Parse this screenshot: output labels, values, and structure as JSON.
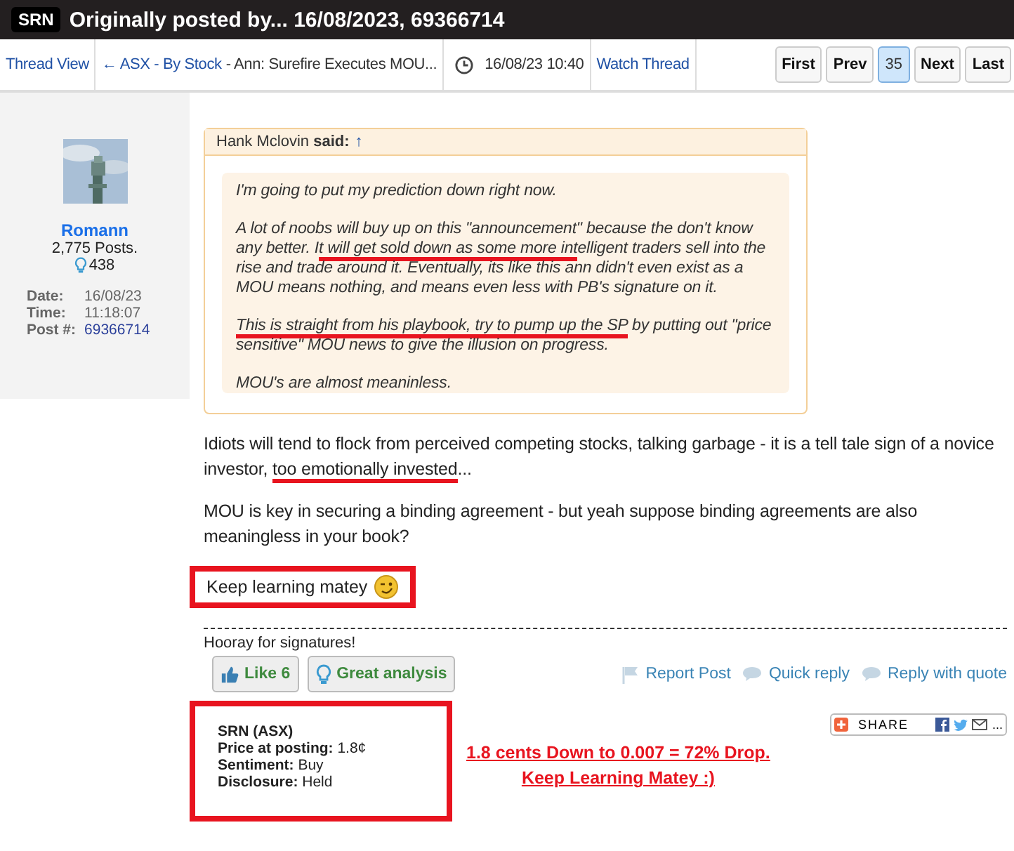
{
  "header": {
    "badge": "SRN",
    "title": "Originally posted by... 16/08/2023, 69366714"
  },
  "nav": {
    "thread_view": "Thread View",
    "crumb_link": "← ASX - By Stock",
    "crumb_rest": "- Ann: Surefire Executes MOU...",
    "time": "16/08/23 10:40",
    "watch": "Watch Thread",
    "pages": [
      {
        "label": "First",
        "selected": false
      },
      {
        "label": "Prev",
        "selected": false
      },
      {
        "label": "35",
        "selected": true
      },
      {
        "label": "Next",
        "selected": false
      },
      {
        "label": "Last",
        "selected": false
      }
    ]
  },
  "author": {
    "name": "Romann",
    "posts": "2,775 Posts.",
    "likes": "438",
    "details": [
      {
        "label": "Date:",
        "value": "16/08/23",
        "kind": "text"
      },
      {
        "label": "Time:",
        "value": "11:18:07",
        "kind": "text"
      },
      {
        "label": "Post #:",
        "value": "69366714",
        "kind": "link"
      }
    ]
  },
  "quote": {
    "heading": "Hank Mclovin **said:**",
    "arrow": "↑",
    "paragraphs": [
      [
        {
          "text": "I'm going to put my prediction down right now.",
          "underlined": false
        }
      ],
      [
        {
          "text": "A lot of noobs will buy up on this \"announcement\" because the don't know any better. I",
          "underlined": false
        },
        {
          "text": "t will get sold down as some more int",
          "underlined": true
        },
        {
          "text": "elligent traders sell into the rise and trade around it. Eventually, its like this ann didn't even exist as a MOU means nothing, and means even less with PB's signature on it.",
          "underlined": false
        }
      ],
      [
        {
          "text": "This is straight from his playbook, try to pump up the SP",
          "underlined": true
        },
        {
          "text": " by putting out \"price sensitive\" MOU news to give the illusion on progress.",
          "underlined": false
        }
      ],
      [
        {
          "text": "MOU's are almost meaninless.",
          "underlined": false
        }
      ]
    ]
  },
  "body": [
    [
      {
        "text": "Idiots will tend to flock from perceived competing stocks, talking garbage - it is a tell tale sign of a novice investor, ",
        "underlined": false
      },
      {
        "text": "too emotionally invested",
        "underlined": true
      },
      {
        "text": "...",
        "underlined": false
      }
    ],
    [
      {
        "text": "MOU is key in securing a binding agreement - but yeah suppose binding agreements are also meaningless in your book?",
        "underlined": false
      }
    ]
  ],
  "closing": {
    "text": "Keep learning matey",
    "highlighted": true
  },
  "signature": "Hooray for signatures!",
  "reactions": [
    {
      "label": "Like 6",
      "kind": "like"
    },
    {
      "label": "Great analysis",
      "kind": "idea"
    }
  ],
  "actions": [
    {
      "label": "Report Post",
      "kind": "flag"
    },
    {
      "label": "Quick reply",
      "kind": "bubble"
    },
    {
      "label": "Reply with quote",
      "kind": "bubble"
    }
  ],
  "disclosure": {
    "highlighted": true,
    "stock": "SRN (ASX)",
    "lines": [
      {
        "label": "Price at posting:",
        "value": "1.8¢"
      },
      {
        "label": "Sentiment:",
        "value": "Buy"
      },
      {
        "label": "Disclosure:",
        "value": "Held"
      }
    ]
  },
  "annotation": [
    "1.8 cents Down to 0.007 = 72%  Drop.",
    "Keep Learning Matey :)"
  ],
  "share": {
    "label": "SHARE",
    "more": "..."
  }
}
